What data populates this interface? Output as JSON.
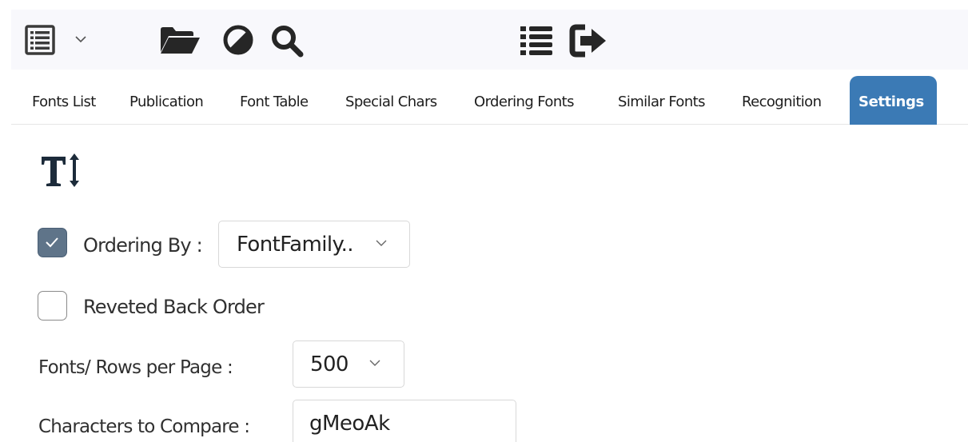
{
  "toolbar": {
    "icons": [
      "list-view-icon",
      "chevron-down-icon",
      "folder-open-icon",
      "contrast-icon",
      "search-icon",
      "list-icon",
      "sign-out-icon"
    ]
  },
  "tabs": [
    {
      "label": "Fonts List",
      "active": false
    },
    {
      "label": "Publication",
      "active": false
    },
    {
      "label": "Font Table",
      "active": false
    },
    {
      "label": "Special Chars",
      "active": false
    },
    {
      "label": "Ordering Fonts",
      "active": false
    },
    {
      "label": "Similar Fonts",
      "active": false
    },
    {
      "label": "Recognition",
      "active": false
    },
    {
      "label": "Settings",
      "active": true
    }
  ],
  "settings": {
    "icon": "text-height-icon",
    "ordering": {
      "checked": true,
      "label": "Ordering By :",
      "selected": "FontFamily.."
    },
    "reversed": {
      "checked": false,
      "label": "Reveted Back Order"
    },
    "rows_per_page": {
      "label": "Fonts/ Rows per Page :",
      "selected": "500"
    },
    "compare": {
      "label": "Characters to Compare :",
      "value": "gMeoAk"
    }
  },
  "colors": {
    "accent": "#3b7ab5",
    "checkbox_checked": "#5f7489",
    "toolbar_bg": "#f8f8fc"
  }
}
